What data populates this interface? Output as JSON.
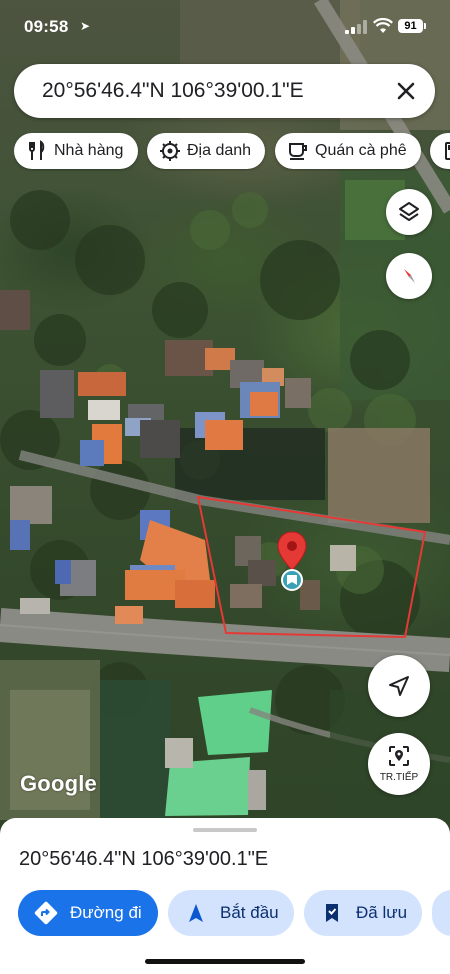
{
  "status_bar": {
    "time": "09:58",
    "battery": "91"
  },
  "search": {
    "query": "20°56'46.4\"N 106°39'00.1\"E"
  },
  "chips": [
    {
      "label": "Nhà hàng",
      "icon": "restaurant-icon"
    },
    {
      "label": "Địa danh",
      "icon": "landmark-icon"
    },
    {
      "label": "Quán cà phê",
      "icon": "coffee-icon"
    },
    {
      "label": "",
      "icon": "gas-station-icon"
    }
  ],
  "map": {
    "fabs": {
      "layers_icon": "layers-icon",
      "compass_icon": "compass-icon",
      "location_icon": "my-location-icon",
      "live_view_label": "TR.TIẾP"
    },
    "logo": "Google",
    "colors": {
      "pin": "#e53935",
      "boundary": "#e53935",
      "road": "#8a8a84",
      "roof_orange": "#e37a3b",
      "roof_blue": "#4f7fc9"
    }
  },
  "sheet": {
    "title": "20°56'46.4\"N 106°39'00.1\"E",
    "buttons": {
      "directions": "Đường đi",
      "start": "Bắt đầu",
      "saved": "Đã lưu"
    },
    "colors": {
      "primary": "#1a73e8",
      "secondary": "#d3e3fd"
    }
  }
}
